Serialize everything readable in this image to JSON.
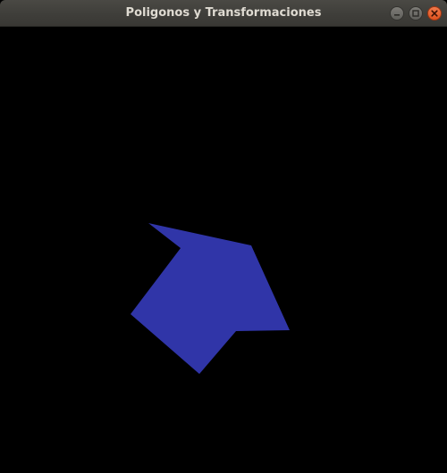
{
  "window": {
    "title": "Poligonos y Transformaciones",
    "controls": {
      "minimize": "minimize-icon",
      "maximize": "maximize-icon",
      "close": "close-icon"
    }
  },
  "canvas": {
    "background": "#000000",
    "shape_color": "#3035a8"
  }
}
